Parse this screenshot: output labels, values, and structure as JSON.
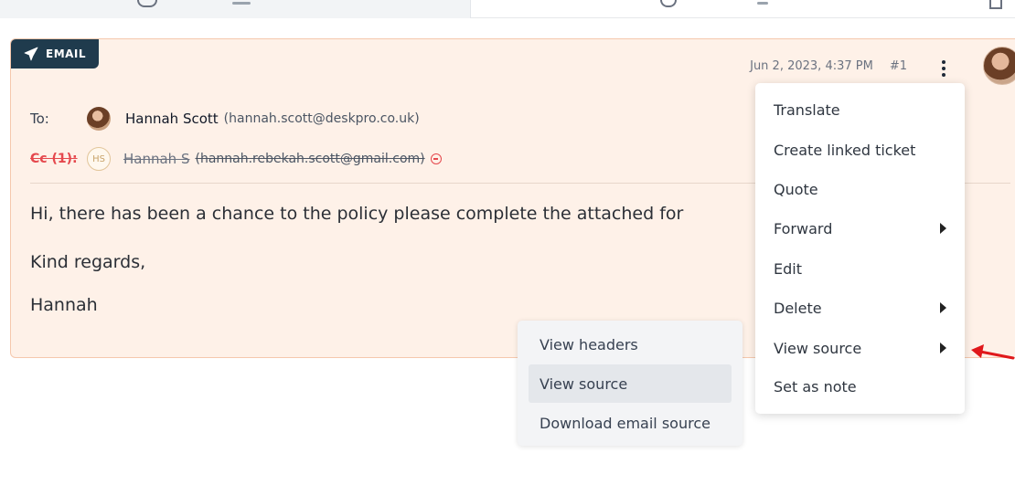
{
  "email": {
    "badge": "EMAIL",
    "date": "Jun 2, 2023, 4:37 PM",
    "number": "#1",
    "to_label": "To:",
    "to_name": "Hannah Scott",
    "to_email": "(hannah.scott@deskpro.co.uk)",
    "cc_label": "Cc (1):",
    "cc_initials": "HS",
    "cc_name": "Hannah S",
    "cc_email": "(hannah.rebekah.scott@gmail.com)",
    "body": [
      "Hi, there has been a chance to the policy please complete the attached for",
      "Kind regards,",
      "Hannah"
    ]
  },
  "menu": {
    "items": [
      {
        "label": "Translate"
      },
      {
        "label": "Create linked ticket"
      },
      {
        "label": "Quote"
      },
      {
        "label": "Forward"
      },
      {
        "label": "Edit"
      },
      {
        "label": "Delete"
      },
      {
        "label": "View source"
      },
      {
        "label": "Set as note"
      }
    ]
  },
  "submenu": {
    "items": [
      {
        "label": "View headers"
      },
      {
        "label": "View source"
      },
      {
        "label": "Download email source"
      }
    ]
  },
  "icons": {
    "badge": "paper-plane-icon",
    "more": "kebab-icon",
    "submenu": "caret-right-icon",
    "remove": "remove-circle-icon",
    "annotation": "red-arrow-icon"
  },
  "colors": {
    "card_bg": "#fef1e8",
    "card_border": "#f5c8ad",
    "badge_bg": "#1f3b4d",
    "cc_red": "#e5484d",
    "annotation_red": "#e0181b"
  }
}
